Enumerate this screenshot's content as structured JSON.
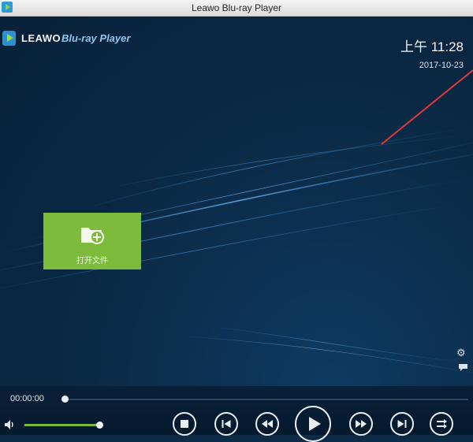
{
  "window": {
    "title": "Leawo Blu-ray Player"
  },
  "logo": {
    "brand": "LEAWO",
    "product": "Blu-ray Player"
  },
  "clock": {
    "time": "上午 11:28",
    "date": "2017-10-23"
  },
  "open_file": {
    "label": "打开文件",
    "icon": "folder-add-icon"
  },
  "side_icons": [
    "gear-icon",
    "subtitle-icon"
  ],
  "player": {
    "current_time": "00:00:00",
    "progress": 0,
    "volume": 1.0
  },
  "controls": [
    {
      "name": "stop-button",
      "icon": "stop-icon"
    },
    {
      "name": "previous-button",
      "icon": "skip-back-icon"
    },
    {
      "name": "rewind-button",
      "icon": "rewind-icon"
    },
    {
      "name": "play-button",
      "icon": "play-icon"
    },
    {
      "name": "fast-forward-button",
      "icon": "fast-forward-icon"
    },
    {
      "name": "next-button",
      "icon": "skip-forward-icon"
    },
    {
      "name": "playlist-button",
      "icon": "playlist-icon"
    }
  ],
  "colors": {
    "background": "#0b2944",
    "accent_green": "#7cbb3c",
    "annotation_red": "#e03a3a"
  }
}
